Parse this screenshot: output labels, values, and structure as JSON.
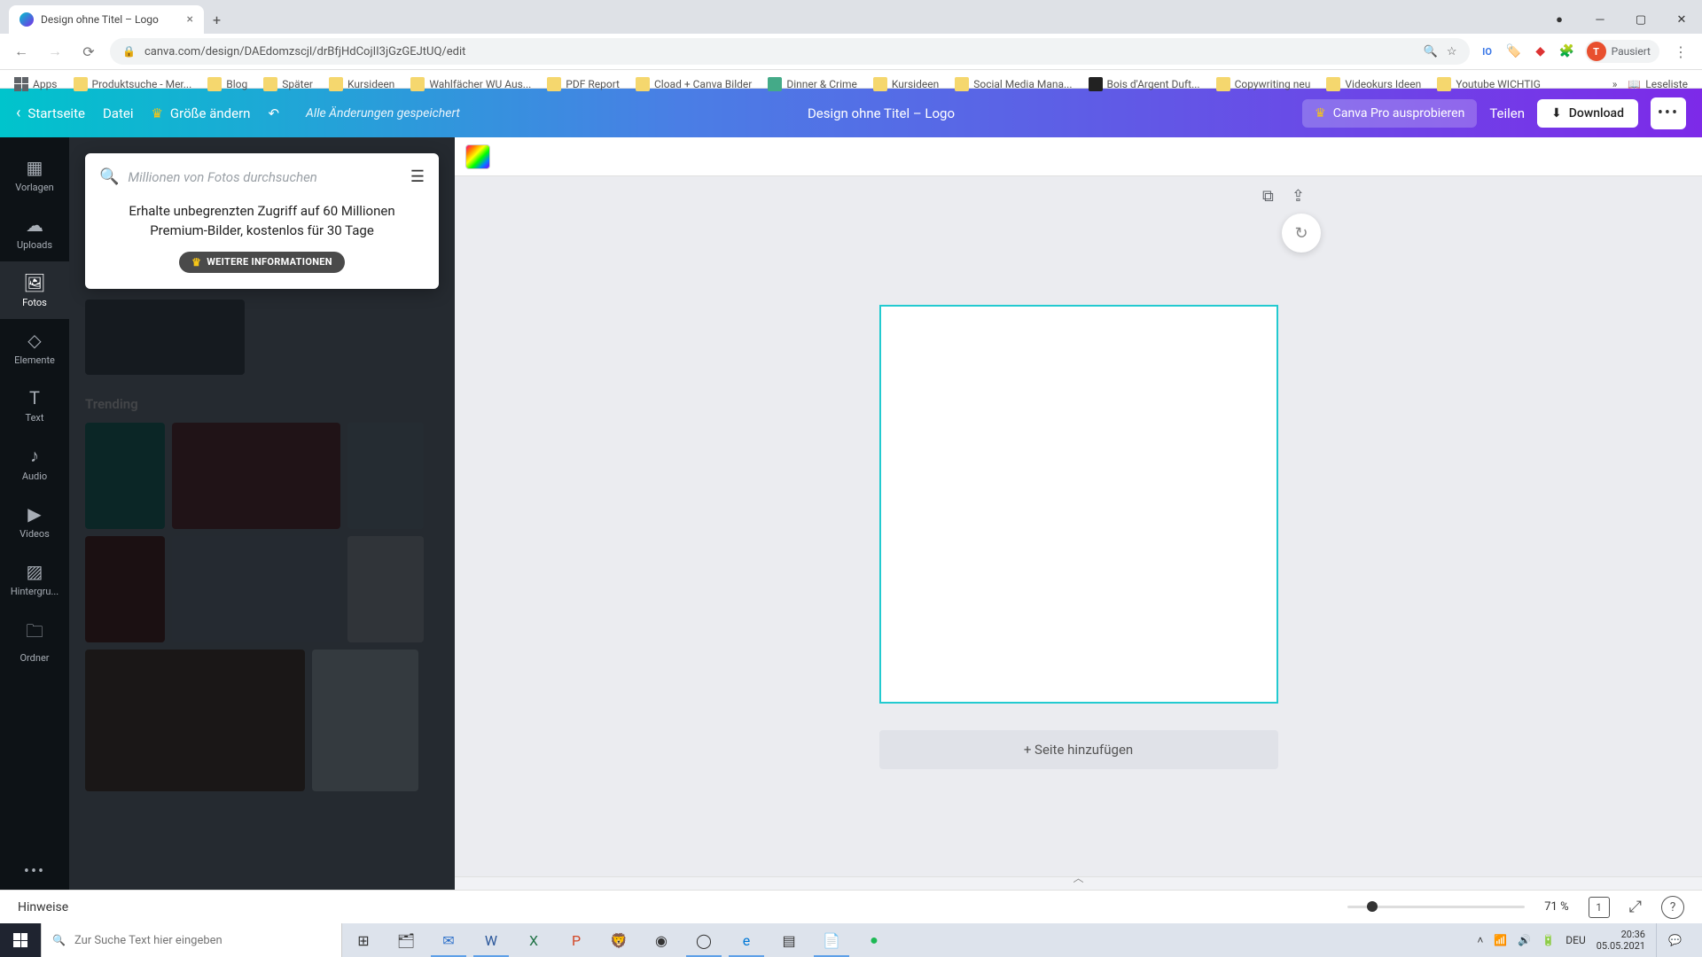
{
  "browser": {
    "tab_title": "Design ohne Titel – Logo",
    "url": "canva.com/design/DAEdomzscjl/drBfjHdCojII3jGzGEJtUQ/edit",
    "user_state": "Pausiert",
    "user_initial": "T",
    "bookmarks": {
      "apps": "Apps",
      "items": [
        "Produktsuche - Mer...",
        "Blog",
        "Später",
        "Kursideen",
        "Wahlfächer WU Aus...",
        "PDF Report",
        "Cload + Canva Bilder",
        "Dinner & Crime",
        "Kursideen",
        "Social Media Mana...",
        "Bois d'Argent Duft...",
        "Copywriting neu",
        "Videokurs Ideen",
        "Youtube WICHTIG"
      ],
      "readlist": "Leseliste"
    }
  },
  "header": {
    "home": "Startseite",
    "file": "Datei",
    "resize": "Größe ändern",
    "save_status": "Alle Änderungen gespeichert",
    "design_title": "Design ohne Titel – Logo",
    "try_pro": "Canva Pro ausprobieren",
    "share": "Teilen",
    "download": "Download"
  },
  "rail": {
    "templates": "Vorlagen",
    "uploads": "Uploads",
    "photos": "Fotos",
    "elements": "Elemente",
    "text": "Text",
    "audio": "Audio",
    "videos": "Videos",
    "background": "Hintergru...",
    "folders": "Ordner"
  },
  "panel": {
    "search_placeholder": "Millionen von Fotos durchsuchen",
    "promo_text": "Erhalte unbegrenzten Zugriff auf 60 Millionen Premium-Bilder, kostenlos für 30 Tage",
    "promo_button": "WEITERE INFORMATIONEN",
    "trending_heading": "Trending"
  },
  "canvas": {
    "add_page": "+ Seite hinzufügen"
  },
  "footer": {
    "notes": "Hinweise",
    "zoom": "71 %",
    "page_number": "1"
  },
  "taskbar": {
    "search_placeholder": "Zur Suche Text hier eingeben",
    "lang": "DEU",
    "time": "20:36",
    "date": "05.05.2021"
  }
}
